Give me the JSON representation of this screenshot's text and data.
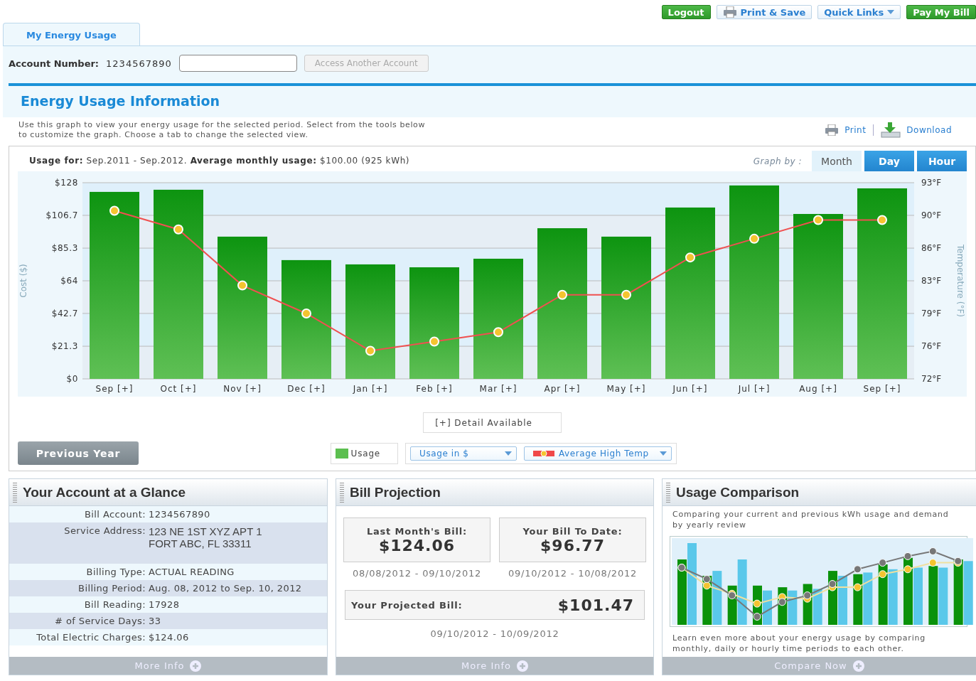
{
  "top_buttons": [
    {
      "label": "Logout",
      "kind": "primary"
    },
    {
      "label": "Print & Save",
      "kind": "print"
    },
    {
      "label": "Quick Links",
      "kind": "dropdown"
    },
    {
      "label": "Pay My Bill",
      "kind": "primary"
    }
  ],
  "tabs": [
    {
      "label": "My Energy Usage",
      "selected": true
    }
  ],
  "account": {
    "label": "Account Number:",
    "number": "1234567890",
    "button": "Access Another Account",
    "button_disabled": true
  },
  "section": {
    "title": "Energy Usage Information",
    "description": "Use this graph to view your energy usage for the selected period. Select from the tools below to customize the graph. Choose a tab to change the selected view.",
    "print": "Print",
    "download": "Download"
  },
  "graph": {
    "summary": "**Usage for:** Sep.2011 - Sep.2012.  **Average monthly usage:** $100.00 (925 kWh)",
    "graph_by": "Graph by :",
    "view_tabs": [
      {
        "label": "Month",
        "selected": true
      },
      {
        "label": "Day",
        "selected": false
      },
      {
        "label": "Hour",
        "selected": false
      }
    ],
    "chart_data": {
      "type": "bar",
      "ylabel": "Cost ($)",
      "y2label": "Temperature (°F)",
      "categories": [
        "Sep [+]",
        "Oct [+]",
        "Nov [+]",
        "Dec [+]",
        "Jan [+]",
        "Feb [+]",
        "Mar [+]",
        "Apr [+]",
        "May [+]",
        "Jun [+]",
        "Jul [+]",
        "Aug [+]",
        "Sep [+]"
      ],
      "series": [
        {
          "name": "Usage",
          "color": "#3aa635",
          "values": [
            122,
            123.4,
            92.8,
            77.5,
            74.7,
            72.8,
            78.4,
            98.3,
            92.8,
            111.8,
            126.2,
            107.6,
            124.3
          ]
        },
        {
          "name": "Average High Temp",
          "color": "#f05050",
          "type": "line",
          "marker": "circle",
          "axis": "y2",
          "values": [
            90,
            88,
            82,
            79,
            75,
            76,
            77,
            81,
            81,
            85,
            87,
            89,
            89
          ]
        }
      ],
      "grid": true,
      "ylim": [
        0,
        128
      ],
      "yticks": [
        {
          "value": 0,
          "label": "$0"
        },
        {
          "value": 21.3,
          "label": "$21.3"
        },
        {
          "value": 42.7,
          "label": "$42.7"
        },
        {
          "value": 64,
          "label": "$64"
        },
        {
          "value": 85.3,
          "label": "$85.3"
        },
        {
          "value": 106.7,
          "label": "$106.7"
        },
        {
          "value": 128,
          "label": "$128"
        }
      ],
      "y2lim": [
        72,
        93
      ],
      "y2ticks": [
        {
          "value": 72,
          "label": "72°F"
        },
        {
          "value": 75.5,
          "label": "76°F"
        },
        {
          "value": 79,
          "label": "79°F"
        },
        {
          "value": 82.5,
          "label": "83°F"
        },
        {
          "value": 86,
          "label": "86°F"
        },
        {
          "value": 89.5,
          "label": "90°F"
        },
        {
          "value": 93,
          "label": "93°F"
        }
      ]
    },
    "detail_note": "[+] Detail Available",
    "previous_button": "Previous Year",
    "selects": [
      {
        "value": "Usage in $",
        "kind": "plain"
      },
      {
        "kind": "temp"
      }
    ]
  },
  "glance": {
    "title": "Your Account at a Glance",
    "rows": [
      {
        "label": "Bill Account:",
        "value": [
          "1234567890"
        ]
      },
      {
        "label": "Service Address:",
        "value": [
          "123 NE 1ST XYZ APT 1",
          "FORT ABC, FL 33311"
        ]
      },
      {
        "label": "Billing Type:",
        "value": [
          "ACTUAL READING"
        ]
      },
      {
        "label": "Billing Period:",
        "value": [
          "Aug. 08, 2012 to Sep. 10, 2012"
        ]
      },
      {
        "label": "Bill Reading:",
        "value": [
          "17928"
        ]
      },
      {
        "label": "# of Service Days:",
        "value": [
          "33"
        ]
      },
      {
        "label": "Total Electric Charges:",
        "value": [
          "$124.06"
        ]
      }
    ],
    "footer": "More Info"
  },
  "projection": {
    "title": "Bill Projection",
    "boxes": [
      {
        "label": "Last Month's Bill:",
        "amount": "$124.06",
        "dates": "08/08/2012 - 09/10/2012"
      },
      {
        "label": "Your Bill To Date:",
        "amount": "$96.77",
        "dates": "09/10/2012 - 10/08/2012"
      }
    ],
    "projected": {
      "label": "Your Projected Bill:",
      "amount": "$101.47",
      "dates": "09/10/2012 - 10/09/2012"
    },
    "footer": "More Info"
  },
  "comparison": {
    "title": "Usage Comparison",
    "intro": "Comparing your current and previous kWh usage and demand by yearly review",
    "outro": "Learn even more about your energy usage by comparing monthly, daily or hourly time periods to each other.",
    "footer": "Compare Now"
  }
}
